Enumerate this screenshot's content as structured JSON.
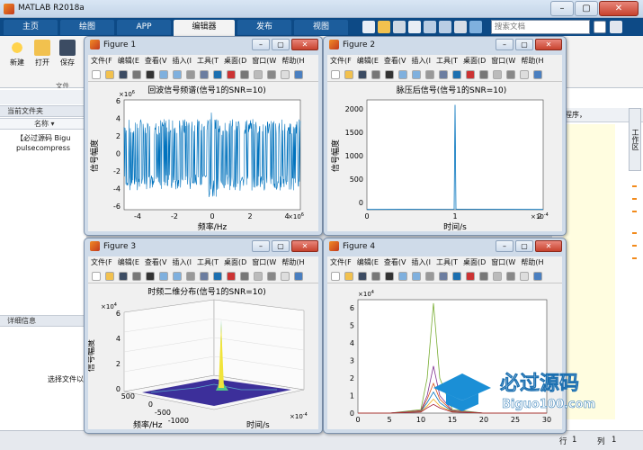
{
  "window": {
    "title": "MATLAB R2018a",
    "minimize": "–",
    "maximize": "▢",
    "close": "✕"
  },
  "tabs": [
    "主页",
    "绘图",
    "APP",
    "编辑器",
    "发布",
    "视图"
  ],
  "active_tab": "编辑器",
  "search": {
    "placeholder": "搜索文档"
  },
  "ribbon": {
    "new": "新建",
    "open": "打开",
    "save": "保存",
    "group": "文件"
  },
  "current_folder": {
    "header": "当前文件夹",
    "column": "名称",
    "sort": "▾",
    "files": [
      "【必过源码 Bigu",
      "pulsecompress"
    ]
  },
  "details": {
    "header": "详细信息",
    "hint": "选择文件以"
  },
  "right_pane": {
    "fragment": "程序，",
    "side_tab": "工作区"
  },
  "statusbar": {
    "row_label": "行",
    "row": "1",
    "col_label": "列",
    "col": "1"
  },
  "figure_menu": [
    "文件(F",
    "编辑(E",
    "查看(V",
    "插入(I",
    "工具(T",
    "桌面(D",
    "窗口(W",
    "帮助(H"
  ],
  "figures": [
    {
      "title": "Figure 1",
      "plot_title": "回波信号频谱(信号1的SNR=10)",
      "xlabel": "频率/Hz",
      "ylabel": "信号幅度",
      "xexp": "×10",
      "xexp_pow": "6",
      "yexp": "×10",
      "yexp_pow": "6",
      "xticks": [
        "-4",
        "-2",
        "0",
        "2",
        "4"
      ],
      "yticks": [
        "6",
        "4",
        "2",
        "0",
        "-2",
        "-4",
        "-6"
      ]
    },
    {
      "title": "Figure 2",
      "plot_title": "脉压后信号(信号1的SNR=10)",
      "xlabel": "时间/s",
      "ylabel": "信号幅度",
      "xexp": "×10",
      "xexp_pow": "-4",
      "xticks": [
        "0",
        "1",
        "2"
      ],
      "yticks": [
        "2000",
        "1500",
        "1000",
        "500",
        "0"
      ]
    },
    {
      "title": "Figure 3",
      "plot_title": "时频二维分布(信号1的SNR=10)",
      "xlabel": "时间/s",
      "ylabel": "频率/Hz",
      "zlabel": "信号幅度",
      "zexp": "×10",
      "zexp_pow": "4",
      "xexp": "×10",
      "xexp_pow": "-4",
      "zticks": [
        "6",
        "4",
        "2",
        "0"
      ],
      "yticks": [
        "500",
        "0",
        "-500",
        "-1000"
      ]
    },
    {
      "title": "Figure 4",
      "yexp": "×10",
      "yexp_pow": "4",
      "xticks": [
        "0",
        "5",
        "10",
        "15",
        "20",
        "25",
        "30"
      ],
      "yticks": [
        "6",
        "5",
        "4",
        "3",
        "2",
        "1",
        "0"
      ]
    }
  ],
  "watermark": {
    "title": "必过源码",
    "url": "Biguo100.com"
  },
  "chart_data": [
    {
      "type": "line",
      "title": "回波信号频谱(信号1的SNR=10)",
      "xlabel": "频率/Hz",
      "ylabel": "信号幅度",
      "xlim": [
        -5000000.0,
        5000000.0
      ],
      "ylim": [
        -6000000.0,
        6000000.0
      ],
      "note": "dense noise-like spectrum filling ±4e6 amplitude"
    },
    {
      "type": "line",
      "title": "脉压后信号(信号1的SNR=10)",
      "xlabel": "时间/s",
      "ylabel": "信号幅度",
      "xlim": [
        0,
        0.0002
      ],
      "ylim": [
        0,
        2200
      ],
      "series": [
        {
          "x": [
            0,
            9.9e-05,
            0.0001,
            0.000101,
            0.0002
          ],
          "values": [
            5,
            10,
            2100,
            10,
            5
          ]
        }
      ]
    },
    {
      "type": "area",
      "title": "时频二维分布(信号1的SNR=10)",
      "xlabel": "时间/s",
      "ylabel": "频率/Hz",
      "zlabel": "信号幅度",
      "ylim": [
        -1000,
        500
      ],
      "zlim": [
        0,
        60000.0
      ],
      "note": "3D surface with narrow peak"
    },
    {
      "type": "line",
      "xlim": [
        0,
        30
      ],
      "ylim": [
        0,
        65000.0
      ],
      "x": [
        0,
        5,
        10,
        11,
        12,
        13,
        15,
        20,
        25,
        30
      ],
      "series": [
        {
          "color": "#77ac30",
          "values": [
            0,
            0,
            2000,
            20000,
            63000,
            20000,
            2000,
            0,
            0,
            0
          ]
        },
        {
          "color": "#7e2f8e",
          "values": [
            0,
            0,
            1500,
            10000,
            27000,
            10000,
            1500,
            0,
            0,
            0
          ]
        },
        {
          "color": "#d95319",
          "values": [
            0,
            0,
            1200,
            8000,
            17000,
            8000,
            1200,
            0,
            0,
            0
          ]
        },
        {
          "color": "#0072bd",
          "values": [
            0,
            0,
            1000,
            6000,
            12000,
            6000,
            1000,
            0,
            0,
            0
          ]
        },
        {
          "color": "#edb120",
          "values": [
            0,
            0,
            800,
            4000,
            8000,
            4000,
            800,
            0,
            0,
            0
          ]
        },
        {
          "color": "#a2142f",
          "values": [
            0,
            0,
            600,
            3000,
            5000,
            3000,
            600,
            0,
            0,
            0
          ]
        }
      ]
    }
  ],
  "colors": {
    "tabbar": "#0d4a86",
    "matlab_blue": "#0072bd",
    "accent_orange": "#f28a1b"
  }
}
